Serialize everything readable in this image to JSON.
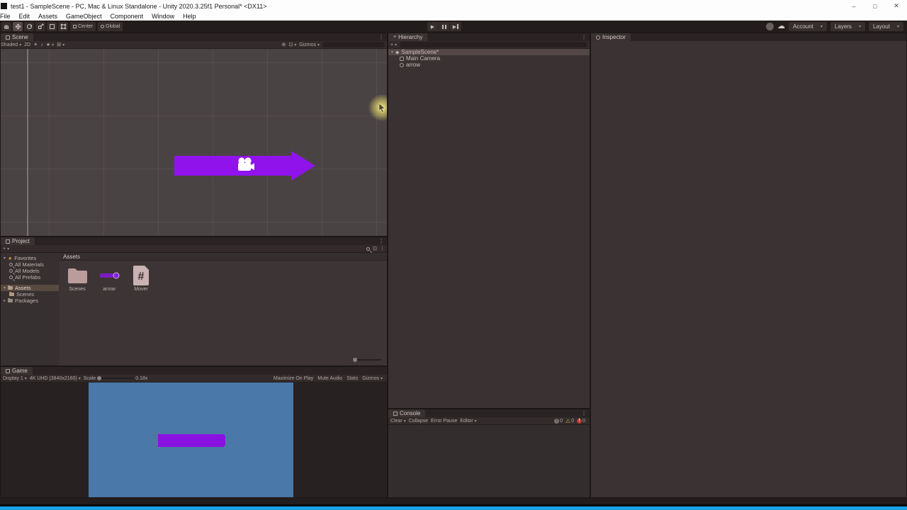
{
  "window": {
    "title": "test1 - SampleScene - PC, Mac & Linux Standalone - Unity 2020.3.25f1 Personal* <DX11>",
    "minimize_glyph": "–",
    "maximize_glyph": "□",
    "close_glyph": "✕"
  },
  "menubar": {
    "items": [
      "File",
      "Edit",
      "Assets",
      "GameObject",
      "Component",
      "Window",
      "Help"
    ]
  },
  "toolbar": {
    "pivot_label": "Center",
    "space_label": "Global",
    "account_label": "Account",
    "layers_label": "Layers",
    "layout_label": "Layout",
    "play_glyph": "▶"
  },
  "scene": {
    "tab_label": "Scene",
    "shading_mode": "Shaded",
    "view_2d_label": "2D",
    "gizmos_label": "Gizmos"
  },
  "hierarchy": {
    "tab_label": "Hierarchy",
    "add_button": "+",
    "items": [
      {
        "label": "SampleScene*"
      },
      {
        "label": "Main Camera"
      },
      {
        "label": "arrow"
      }
    ]
  },
  "inspector": {
    "tab_label": "Inspector"
  },
  "project": {
    "tab_label": "Project",
    "add_button": "+",
    "favorites_label": "Favorites",
    "favorites": [
      "All Materials",
      "All Models",
      "All Prefabs"
    ],
    "assets_label": "Assets",
    "scenes_label": "Scenes",
    "packages_label": "Packages",
    "breadcrumb": "Assets",
    "items": [
      {
        "label": "Scenes",
        "type": "folder"
      },
      {
        "label": "arrow",
        "type": "sprite"
      },
      {
        "label": "Mover",
        "type": "script"
      }
    ]
  },
  "game": {
    "tab_label": "Game",
    "display": "Display 1",
    "resolution": "4K UHD (3840x2160)",
    "scale_label": "Scale",
    "scale_value": "0.18x",
    "maximize_label": "Maximize On Play",
    "mute_label": "Mute Audio",
    "stats_label": "Stats",
    "gizmos_label": "Gizmos"
  },
  "console": {
    "tab_label": "Console",
    "clear_label": "Clear",
    "collapse_label": "Collapse",
    "error_pause_label": "Error Pause",
    "editor_label": "Editor",
    "info_count": "0",
    "warning_count": "0",
    "error_count": "0"
  },
  "colors": {
    "sprite_purple": "#9013ec",
    "game_sprite_purple": "#8a12e0",
    "camera_background_blue": "#4a78a8",
    "selection_highlight": "#544747",
    "progress_bar_blue": "#18a3e9",
    "click_glow_yellow": "#faee6e"
  }
}
